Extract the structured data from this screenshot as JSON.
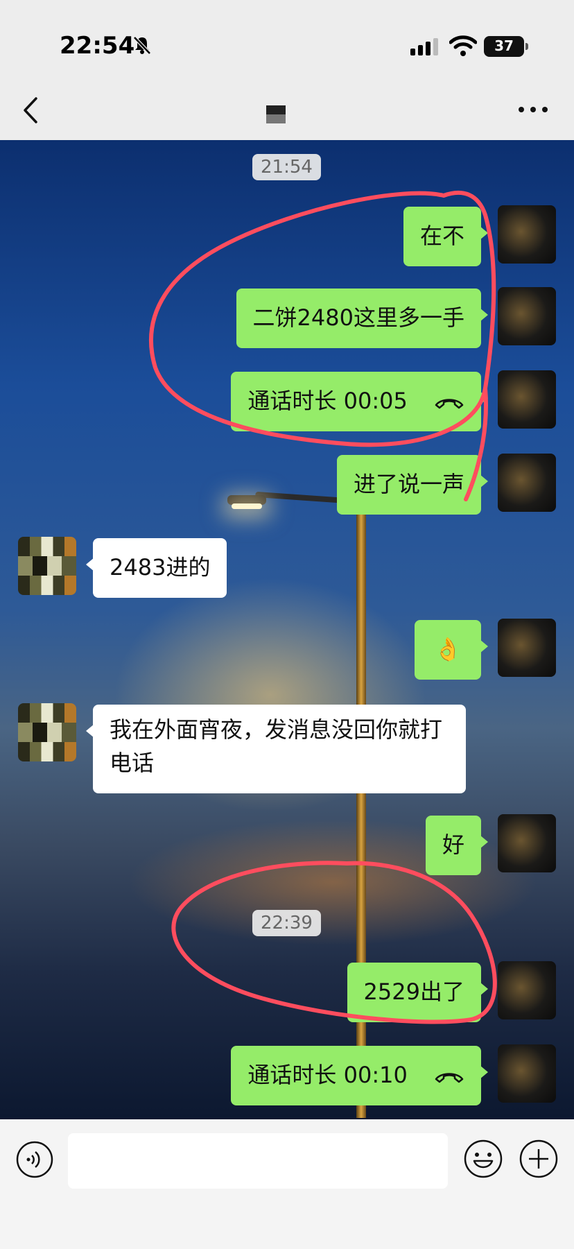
{
  "status_bar": {
    "time": "22:54",
    "battery": "37",
    "icons": [
      "bell-muted-icon",
      "cellular-signal-icon",
      "wifi-icon",
      "battery-icon"
    ]
  },
  "header": {
    "back_icon": "chevron-left-icon",
    "more_icon": "ellipsis-icon"
  },
  "chat": {
    "timestamps": [
      "21:54",
      "22:39"
    ],
    "messages": [
      {
        "side": "self",
        "text": "在不"
      },
      {
        "side": "self",
        "text": "二饼2480这里多一手"
      },
      {
        "side": "self",
        "text": "通话时长 00:05",
        "icon": "phone-hangup-icon"
      },
      {
        "side": "self",
        "text": "进了说一声"
      },
      {
        "side": "other",
        "text": "2483进的"
      },
      {
        "side": "self",
        "text": "👌"
      },
      {
        "side": "other",
        "text": "我在外面宵夜，发消息没回你就打电话"
      },
      {
        "side": "self",
        "text": "好"
      },
      {
        "side": "self",
        "text": "2529出了"
      },
      {
        "side": "self",
        "text": "通话时长 00:10",
        "icon": "phone-hangup-icon"
      }
    ]
  },
  "input_bar": {
    "placeholder": "",
    "voice_icon": "voice-icon",
    "emoji_icon": "emoji-icon",
    "plus_icon": "plus-icon"
  },
  "colors": {
    "self_bubble": "#95ec69",
    "other_bubble": "#ffffff",
    "annotation": "#ff4d5e"
  }
}
